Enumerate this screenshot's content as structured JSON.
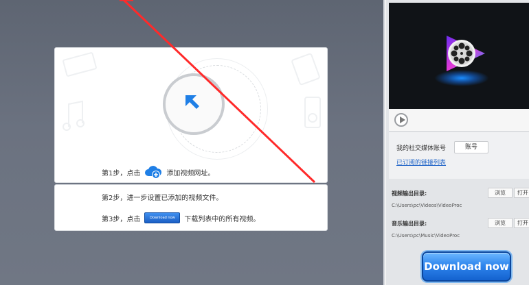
{
  "guide": {
    "step1_prefix": "第1步，点击",
    "step1_suffix": "添加视频网址。",
    "step2": "第2步，进一步设置已添加的视频文件。",
    "step3_prefix": "第3步，点击",
    "step3_button": "Download now",
    "step3_suffix": "下载列表中的所有视频。"
  },
  "sidebar": {
    "social_label": "我的社交媒体账号",
    "account_button": "账号",
    "subscribed_link": "已订阅的链接列表",
    "video_output_label": "视频输出目录:",
    "video_output_path": "C:\\Users\\pc\\Videos\\VideoProc",
    "music_output_label": "音乐输出目录:",
    "music_output_path": "C:\\Users\\pc\\Music\\VideoProc",
    "browse_label": "浏览",
    "open_label": "打开",
    "download_now": "Download now"
  },
  "icons": {
    "upload": "upload-arrow-icon",
    "add_url": "cloud-plus-icon",
    "play": "play-icon",
    "logo": "videoproc-logo"
  },
  "colors": {
    "accent_blue": "#1f7fe6",
    "link_blue": "#1d62c7",
    "annotation_red": "#ff2a2a"
  }
}
